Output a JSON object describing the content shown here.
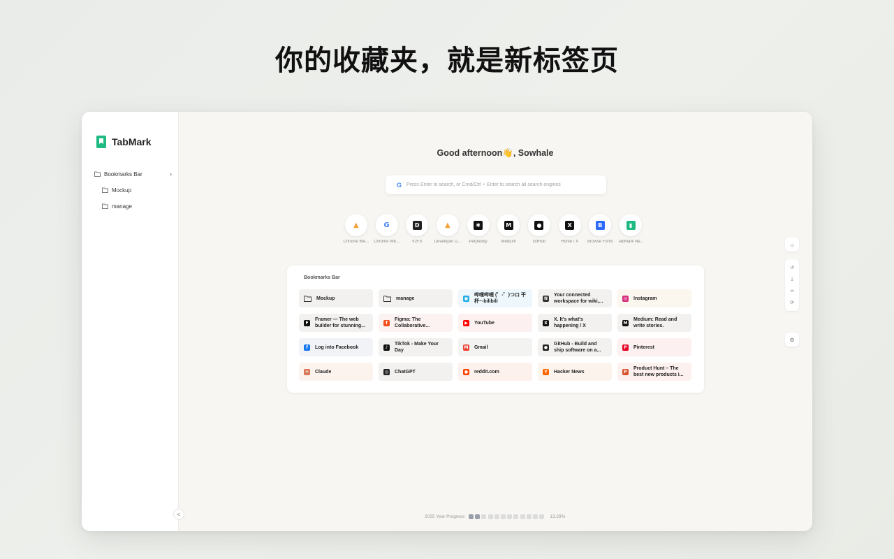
{
  "headline": "你的收藏夹，就是新标签页",
  "app": {
    "name": "TabMark",
    "accent": "#1fb982"
  },
  "sidebar": {
    "root": "Bookmarks Bar",
    "items": [
      "Mockup",
      "manage"
    ],
    "collapse_label": "<"
  },
  "greeting": "Good afternoon👋, Sowhale",
  "search": {
    "engine_icon": "google-icon",
    "placeholder": "Press Enter to search, or Cmd/Ctrl + Enter to search all search engines"
  },
  "shortcuts": [
    {
      "label": "Chrome We...",
      "icon": "chrome-web-store-icon",
      "glyph": "▲",
      "color": "#f0a13a"
    },
    {
      "label": "Chrome We...",
      "icon": "google-icon",
      "glyph": "G",
      "color": "#4285f4"
    },
    {
      "label": "V2FX",
      "icon": "v2fx-icon",
      "glyph": "D",
      "color": "#222222"
    },
    {
      "label": "Developer D...",
      "icon": "developer-dashboard-icon",
      "glyph": "▲",
      "color": "#f0a13a"
    },
    {
      "label": "Perplexity",
      "icon": "perplexity-icon",
      "glyph": "✱",
      "color": "#111111"
    },
    {
      "label": "Medium",
      "icon": "medium-icon",
      "glyph": "M",
      "color": "#111111"
    },
    {
      "label": "GitHub",
      "icon": "github-icon",
      "glyph": "●",
      "color": "#111111"
    },
    {
      "label": "Home / X",
      "icon": "x-icon",
      "glyph": "X",
      "color": "#111111"
    },
    {
      "label": "Browse Fonts",
      "icon": "fonts-icon",
      "glyph": "B",
      "color": "#2f6bff"
    },
    {
      "label": "TabMark Ne...",
      "icon": "tabmark-icon",
      "glyph": "▮",
      "color": "#1fb982"
    }
  ],
  "bookmarks": {
    "title": "Bookmarks Bar",
    "cards": [
      {
        "label": "Mockup",
        "icon": "folder-icon",
        "glyph": "",
        "color": "#444444",
        "bg": "#f2f1ef"
      },
      {
        "label": "manage",
        "icon": "folder-icon",
        "glyph": "",
        "color": "#444444",
        "bg": "#f2f1ef"
      },
      {
        "label": "哔哩哔哩 (゜-゜)つロ 干杯~-bilibili",
        "icon": "bilibili-icon",
        "glyph": "▣",
        "color": "#23ade5",
        "bg": "#eef7fb"
      },
      {
        "label": "Your connected workspace for wiki,...",
        "icon": "notion-icon",
        "glyph": "N",
        "color": "#333333",
        "bg": "#f2f1ef"
      },
      {
        "label": "Instagram",
        "icon": "instagram-icon",
        "glyph": "◎",
        "color": "#d6307e",
        "bg": "#fcf7ee"
      },
      {
        "label": "Framer — The web builder for stunning...",
        "icon": "framer-icon",
        "glyph": "F",
        "color": "#111111",
        "bg": "#f2f1ef"
      },
      {
        "label": "Figma: The Collaborative...",
        "icon": "figma-icon",
        "glyph": "f",
        "color": "#f24e1e",
        "bg": "#fbf2f1"
      },
      {
        "label": "YouTube",
        "icon": "youtube-icon",
        "glyph": "▶",
        "color": "#ff0000",
        "bg": "#fdf0f0"
      },
      {
        "label": "X. It's what's happening / X",
        "icon": "x-icon",
        "glyph": "X",
        "color": "#111111",
        "bg": "#f2f1ef"
      },
      {
        "label": "Medium: Read and write stories.",
        "icon": "medium-icon",
        "glyph": "M",
        "color": "#111111",
        "bg": "#f2f1ef"
      },
      {
        "label": "Log into Facebook",
        "icon": "facebook-icon",
        "glyph": "f",
        "color": "#1877f2",
        "bg": "#f2f3f6"
      },
      {
        "label": "TikTok - Make Your Day",
        "icon": "tiktok-icon",
        "glyph": "♪",
        "color": "#111111",
        "bg": "#f2f1ef"
      },
      {
        "label": "Gmail",
        "icon": "gmail-icon",
        "glyph": "M",
        "color": "#ea4335",
        "bg": "#f3f4f1"
      },
      {
        "label": "GitHub - Build and ship software on a...",
        "icon": "github-icon",
        "glyph": "●",
        "color": "#222222",
        "bg": "#f2f1ef"
      },
      {
        "label": "Pinterest",
        "icon": "pinterest-icon",
        "glyph": "P",
        "color": "#e60023",
        "bg": "#fdf0f0"
      },
      {
        "label": "Claude",
        "icon": "claude-icon",
        "glyph": "✳",
        "color": "#d97757",
        "bg": "#fcf3ee"
      },
      {
        "label": "ChatGPT",
        "icon": "chatgpt-icon",
        "glyph": "◎",
        "color": "#222222",
        "bg": "#f2f1ef"
      },
      {
        "label": "reddit.com",
        "icon": "reddit-icon",
        "glyph": "●",
        "color": "#ff4500",
        "bg": "#fcf1ec"
      },
      {
        "label": "Hacker News",
        "icon": "hacker-news-icon",
        "glyph": "Y",
        "color": "#ff6600",
        "bg": "#fcf4ec"
      },
      {
        "label": "Product Hunt – The best new products i...",
        "icon": "product-hunt-icon",
        "glyph": "P",
        "color": "#da552f",
        "bg": "#fcf1ee"
      }
    ]
  },
  "progress": {
    "label": "2025 Year Progress",
    "percent_text": "13.29%",
    "fraction": 0.1329,
    "dot_count": 12
  }
}
